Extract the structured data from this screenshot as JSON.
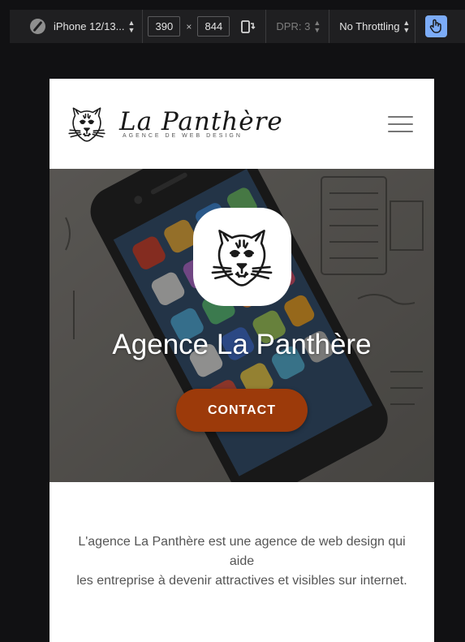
{
  "devtools": {
    "device": "iPhone 12/13...",
    "width": "390",
    "times": "×",
    "height": "844",
    "dpr": "DPR: 3",
    "throttling": "No Throttling",
    "accent": "#7cacf8"
  },
  "site": {
    "brand_name": "La Panthère",
    "brand_tagline": "AGENCE DE WEB DESIGN",
    "hero_title": "Agence La Panthère",
    "contact_label": "CONTACT",
    "contact_color": "#9c3a0a",
    "intro_line1": "L'agence La Panthère est une agence de web design qui aide",
    "intro_line2": "les entreprise à devenir attractives et visibles sur internet."
  },
  "icons": {
    "brand": "panther-logo-icon",
    "menu": "hamburger-menu-icon",
    "rotate": "rotate-device-icon",
    "touch": "touch-hand-icon",
    "compass": "compass-icon"
  }
}
